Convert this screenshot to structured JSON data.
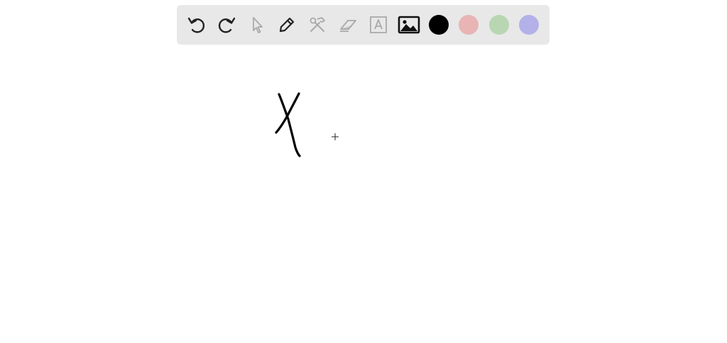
{
  "toolbar": {
    "tools": [
      {
        "name": "undo",
        "icon": "undo-icon",
        "enabled": true
      },
      {
        "name": "redo",
        "icon": "redo-icon",
        "enabled": true
      },
      {
        "name": "select",
        "icon": "pointer-icon",
        "enabled": false
      },
      {
        "name": "pen",
        "icon": "pencil-icon",
        "enabled": true
      },
      {
        "name": "tools",
        "icon": "hammer-wrench-icon",
        "enabled": false
      },
      {
        "name": "eraser",
        "icon": "eraser-icon",
        "enabled": false
      },
      {
        "name": "text",
        "icon": "text-box-icon",
        "enabled": false
      },
      {
        "name": "image",
        "icon": "image-icon",
        "enabled": true
      }
    ],
    "colors": [
      "#000000",
      "#e8b4b4",
      "#b9d6b3",
      "#b3b1e8"
    ],
    "selected_color": "#000000"
  },
  "canvas": {
    "handwritten_text": "X"
  }
}
